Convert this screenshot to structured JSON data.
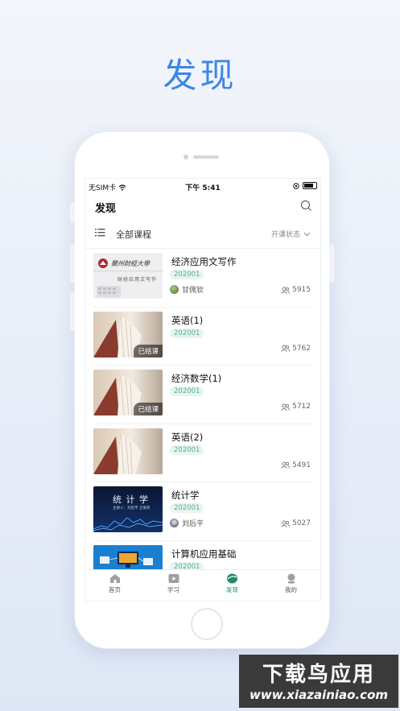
{
  "hero": {
    "title": "发现"
  },
  "status_bar": {
    "carrier": "无SIM卡",
    "time": "下午 5:41"
  },
  "nav": {
    "title": "发现",
    "search_icon": "search-icon"
  },
  "filter": {
    "all_courses": "全部课程",
    "status_filter": "开课状态"
  },
  "courses": [
    {
      "title": "经济应用文写作",
      "term": "202001",
      "teacher": "甘佩钦",
      "count": "5915",
      "ended": "",
      "thumb_text": "蘭州財經大學",
      "thumb_sub": "财经应用文写作"
    },
    {
      "title": "英语(1)",
      "term": "202001",
      "teacher": "",
      "count": "5762",
      "ended": "已结课"
    },
    {
      "title": "经济数学(1)",
      "term": "202001",
      "teacher": "",
      "count": "5712",
      "ended": "已结课"
    },
    {
      "title": "英语(2)",
      "term": "202001",
      "teacher": "",
      "count": "5491",
      "ended": ""
    },
    {
      "title": "统计学",
      "term": "202001",
      "teacher": "刘后平",
      "count": "5027",
      "ended": "",
      "thumb_text": "统 计 学",
      "thumb_sub": "主讲人：刘后平 王丽英"
    },
    {
      "title": "计算机应用基础",
      "term": "202001",
      "teacher": "",
      "count": "",
      "ended": ""
    }
  ],
  "tabs": [
    {
      "label": "首页",
      "icon": "home-icon"
    },
    {
      "label": "学习",
      "icon": "play-icon"
    },
    {
      "label": "发现",
      "icon": "discover-icon",
      "active": true
    },
    {
      "label": "我的",
      "icon": "profile-icon"
    }
  ],
  "watermark": {
    "top": "下载鸟应用",
    "bottom": "www.xiazainiao.com"
  },
  "colors": {
    "accent": "#1f8a66",
    "hero": "#3d86e6",
    "term_text": "#5aae8e"
  }
}
